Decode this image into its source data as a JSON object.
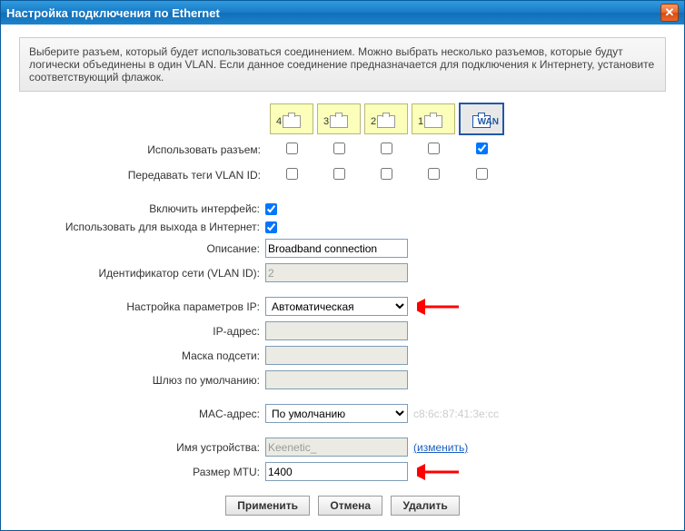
{
  "title": "Настройка подключения по Ethernet",
  "hint": "Выберите разъем, который будет использоваться соединением. Можно выбрать несколько разъемов, которые будут логически объединены в один VLAN. Если данное соединение предназначается для подключения к Интернету, установите соответствующий флажок.",
  "ports": {
    "labels": [
      "4",
      "3",
      "2",
      "1",
      "WAN"
    ],
    "use_port_label": "Использовать разъем:",
    "use_port_checked": [
      false,
      false,
      false,
      false,
      true
    ],
    "vlan_tag_label": "Передавать теги VLAN ID:",
    "vlan_tag_checked": [
      false,
      false,
      false,
      false,
      false
    ]
  },
  "fields": {
    "enable_label": "Включить интерфейс:",
    "enable_checked": true,
    "internet_label": "Использовать для выхода в Интернет:",
    "internet_checked": true,
    "desc_label": "Описание:",
    "desc_value": "Broadband connection",
    "vlan_id_label": "Идентификатор сети (VLAN ID):",
    "vlan_id_value": "2",
    "ip_mode_label": "Настройка параметров IP:",
    "ip_mode_value": "Автоматическая",
    "ip_addr_label": "IP-адрес:",
    "ip_addr_value": "",
    "mask_label": "Маска подсети:",
    "mask_value": "",
    "gateway_label": "Шлюз по умолчанию:",
    "gateway_value": "",
    "mac_label": "MAC-адрес:",
    "mac_mode_value": "По умолчанию",
    "mac_ghost": "c8:6c:87:41:3e:cc",
    "device_name_label": "Имя устройства:",
    "device_name_value": "Keenetic_",
    "change_link": "(изменить)",
    "mtu_label": "Размер MTU:",
    "mtu_value": "1400"
  },
  "buttons": {
    "apply": "Применить",
    "cancel": "Отмена",
    "delete": "Удалить"
  }
}
